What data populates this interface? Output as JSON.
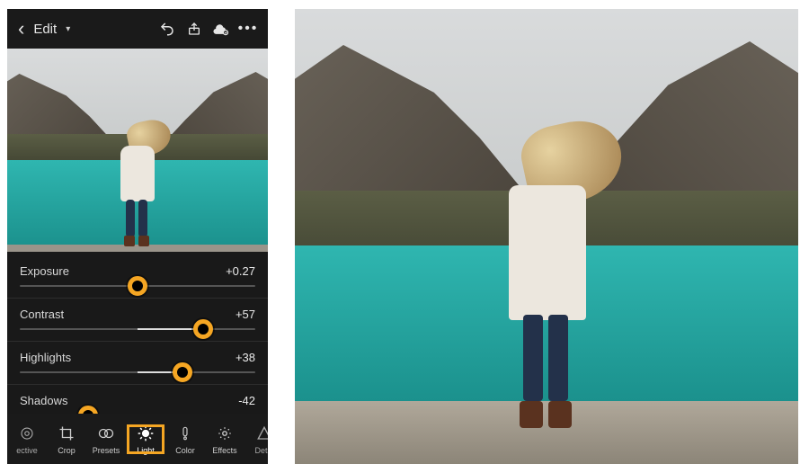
{
  "topbar": {
    "title": "Edit",
    "icons": [
      "undo",
      "share",
      "cloud-sync",
      "more"
    ]
  },
  "sliders": [
    {
      "label": "Exposure",
      "value_text": "+0.27",
      "value": 0.27,
      "min": -5,
      "max": 5,
      "handle_pct": 50
    },
    {
      "label": "Contrast",
      "value_text": "+57",
      "value": 57,
      "min": -100,
      "max": 100,
      "handle_pct": 78
    },
    {
      "label": "Highlights",
      "value_text": "+38",
      "value": 38,
      "min": -100,
      "max": 100,
      "handle_pct": 69
    },
    {
      "label": "Shadows",
      "value_text": "-42",
      "value": -42,
      "min": -100,
      "max": 100,
      "handle_pct": 29
    }
  ],
  "toolbar": [
    {
      "key": "selective",
      "label": "ective",
      "selected": false,
      "partial": true
    },
    {
      "key": "crop",
      "label": "Crop",
      "selected": false
    },
    {
      "key": "presets",
      "label": "Presets",
      "selected": false
    },
    {
      "key": "light",
      "label": "Light",
      "selected": true
    },
    {
      "key": "color",
      "label": "Color",
      "selected": false
    },
    {
      "key": "effects",
      "label": "Effects",
      "selected": false
    },
    {
      "key": "detail",
      "label": "Detai",
      "selected": false,
      "partial": true
    }
  ],
  "colors": {
    "accent": "#f5a623",
    "bg": "#1a1a1a",
    "lake": "#2fb6b0"
  }
}
